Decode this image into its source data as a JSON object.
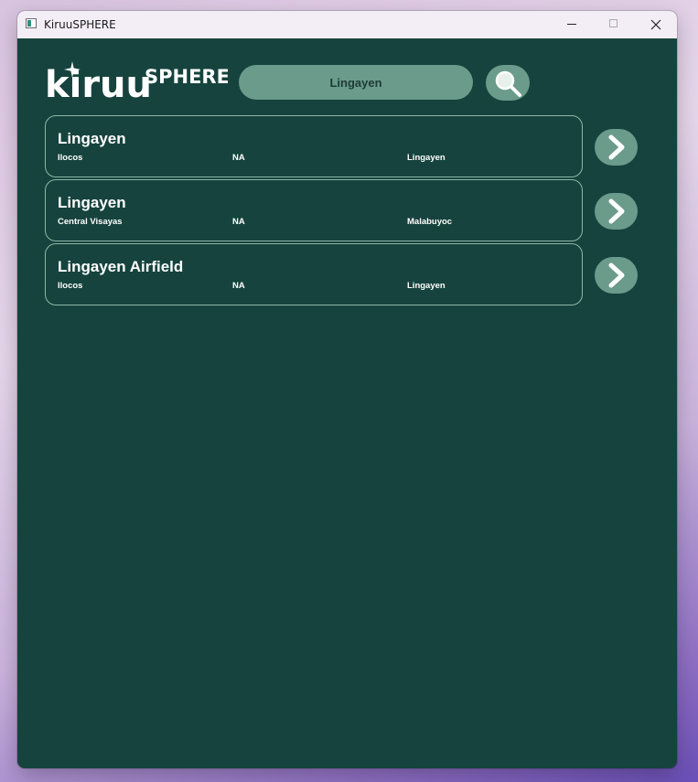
{
  "window": {
    "title": "KiruuSPHERE"
  },
  "logo": {
    "text_main": "kiruu",
    "text_super": "SPHERE"
  },
  "search": {
    "value": "Lingayen"
  },
  "results": [
    {
      "name": "Lingayen",
      "region": "Ilocos",
      "code": "NA",
      "city": "Lingayen"
    },
    {
      "name": "Lingayen",
      "region": "Central Visayas",
      "code": "NA",
      "city": "Malabuyoc"
    },
    {
      "name": "Lingayen Airfield",
      "region": "Ilocos",
      "code": "NA",
      "city": "Lingayen"
    }
  ],
  "colors": {
    "background": "#16433d",
    "button": "#6a9b8b",
    "card_border": "#8fb7aa"
  }
}
